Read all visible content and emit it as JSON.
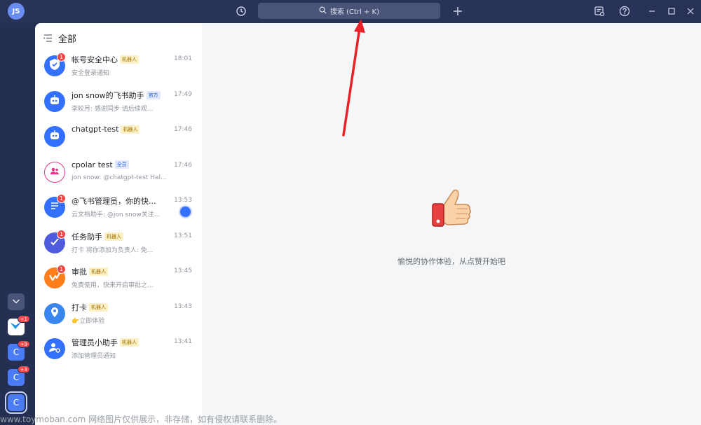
{
  "user": {
    "initials": "JS"
  },
  "titlebar": {
    "search_placeholder": "搜索 (Ctrl + K)",
    "icons": [
      "history-icon",
      "plus-icon",
      "notes-icon",
      "help-icon",
      "minimize-icon",
      "maximize-icon",
      "close-icon"
    ]
  },
  "rail": {
    "apps": [
      {
        "label": "",
        "badge": "+1"
      },
      {
        "label": "C",
        "badge": "+9"
      },
      {
        "label": "C",
        "badge": "+3"
      },
      {
        "label": "C",
        "badge": ""
      }
    ]
  },
  "list": {
    "header": "全部",
    "chats": [
      {
        "name": "帐号安全中心",
        "tag": "机器人",
        "tag_type": "bot",
        "time": "18:01",
        "preview": "安全登录通知",
        "unread": "1",
        "icon": "shield-icon",
        "color": "#3370ff"
      },
      {
        "name": "jon snow的飞书助手",
        "tag": "官方",
        "tag_type": "off",
        "time": "17:49",
        "preview": "李皎月: 感谢同步 请后续观...",
        "unread": "",
        "icon": "robot-icon",
        "color": "#3370ff"
      },
      {
        "name": "chatgpt-test",
        "tag": "机器人",
        "tag_type": "bot",
        "time": "17:46",
        "preview": "",
        "unread": "",
        "icon": "robot-icon",
        "color": "#3370ff"
      },
      {
        "name": "cpolar test",
        "tag": "全员",
        "tag_type": "off",
        "time": "17:46",
        "preview": "jon snow: @chatgpt-test Hal...",
        "unread": "",
        "icon": "group-icon",
        "color": "#e8358b"
      },
      {
        "name": "@飞书管理员，你的快...",
        "tag": "",
        "tag_type": "",
        "time": "13:53",
        "preview": "云文档助手: @jon snow关注...",
        "unread": "1",
        "icon": "doc-icon",
        "color": "#3370ff"
      },
      {
        "name": "任务助手",
        "tag": "机器人",
        "tag_type": "bot",
        "time": "13:51",
        "preview": "打卡 将你添加为负责人: 免...",
        "unread": "1",
        "icon": "task-icon",
        "color": "#4e5bdc"
      },
      {
        "name": "审批",
        "tag": "机器人",
        "tag_type": "bot",
        "time": "13:45",
        "preview": "免费使用，快来开启审批之...",
        "unread": "1",
        "icon": "approval-icon",
        "color": "#ff7d1a"
      },
      {
        "name": "打卡",
        "tag": "机器人",
        "tag_type": "bot",
        "time": "13:43",
        "preview": "👉立即体验",
        "unread": "",
        "icon": "location-icon",
        "color": "#3a86f0"
      },
      {
        "name": "管理员小助手",
        "tag": "机器人",
        "tag_type": "bot",
        "time": "13:41",
        "preview": "添加管理员通知",
        "unread": "",
        "icon": "admin-icon",
        "color": "#3370ff"
      }
    ]
  },
  "main": {
    "empty_text": "愉悦的协作体验，从点赞开始吧"
  },
  "watermark": "www.toymoban.com 网络图片仅供展示，非存储，如有侵权请联系删除。"
}
